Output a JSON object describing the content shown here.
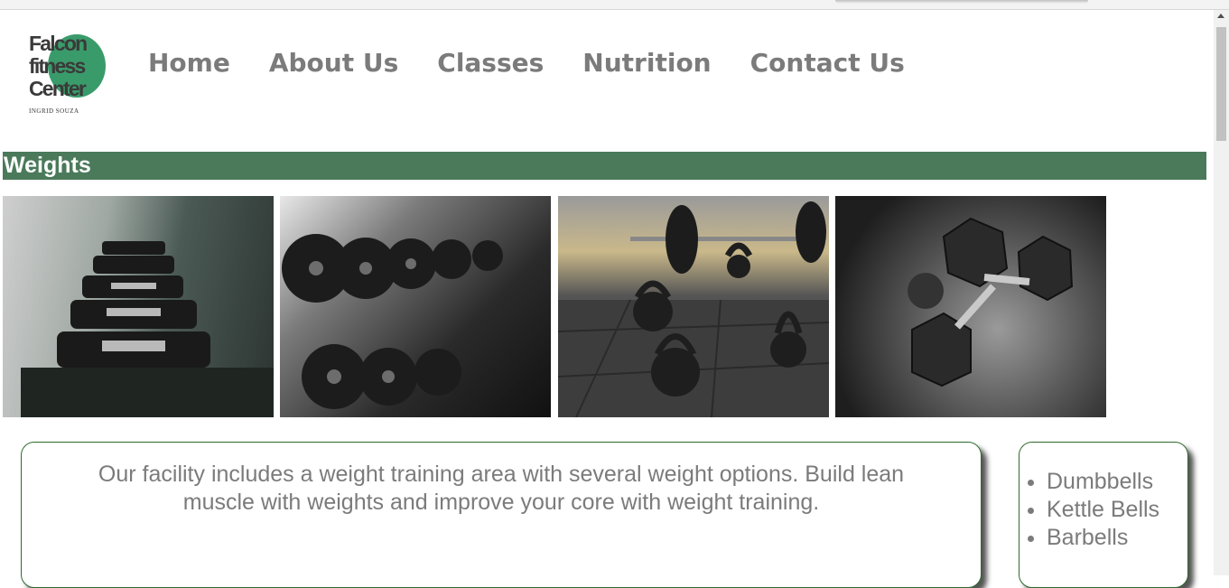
{
  "logo": {
    "line1": "Falcon",
    "line2": "fitness",
    "line3": "Center",
    "signature": "INGRID SOUZA"
  },
  "nav": {
    "items": [
      "Home",
      "About Us",
      "Classes",
      "Nutrition",
      "Contact Us"
    ]
  },
  "section": {
    "title": "Weights"
  },
  "gallery": {
    "images": [
      "dumbbell-rack-photo",
      "dumbbell-rows-photo",
      "kettlebells-photo",
      "hex-dumbbells-photo"
    ]
  },
  "main": {
    "description": "Our facility includes a weight training area with several weight options. Build lean muscle with weights and improve your core with weight training."
  },
  "equipment": {
    "items": [
      "Dumbbells",
      "Kettle Bells",
      "Barbells"
    ]
  },
  "colors": {
    "section_bar": "#4a7a5a",
    "logo_circle": "#3a9b6a",
    "nav_text": "#7b7b7b",
    "box_border": "#2d6b2d"
  }
}
